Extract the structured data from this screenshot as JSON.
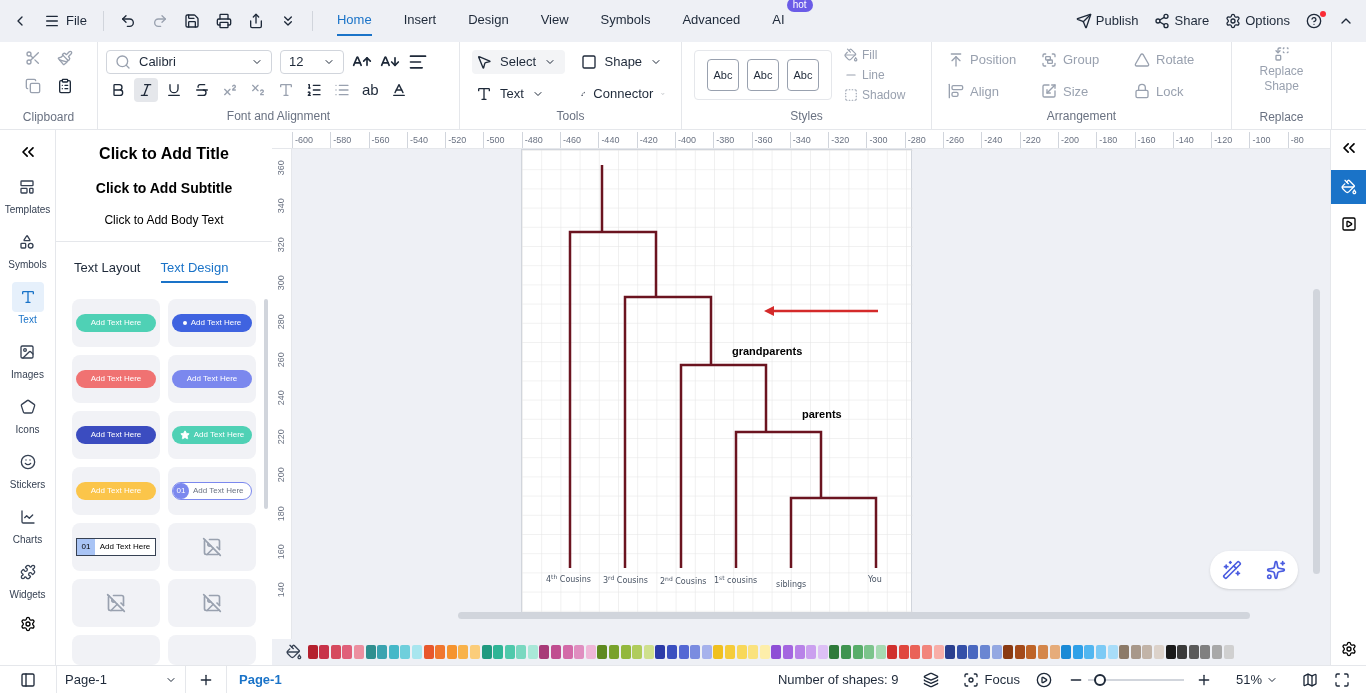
{
  "top_bar": {
    "file": "File"
  },
  "menu_tabs": [
    {
      "label": "Home",
      "selected": true
    },
    {
      "label": "Insert",
      "selected": false
    },
    {
      "label": "Design",
      "selected": false
    },
    {
      "label": "View",
      "selected": false
    },
    {
      "label": "Symbols",
      "selected": false
    },
    {
      "label": "Advanced",
      "selected": false
    },
    {
      "label": "AI",
      "selected": false,
      "badge": "hot"
    }
  ],
  "top_actions": [
    {
      "kind": "publish",
      "label": "Publish"
    },
    {
      "kind": "share",
      "label": "Share"
    },
    {
      "kind": "options",
      "label": "Options"
    }
  ],
  "help": {
    "notification": true
  },
  "ribbon": {
    "clipboard": {
      "title": "Clipboard"
    },
    "font": {
      "title": "Font and Alignment",
      "family": "Calibri",
      "size": "12",
      "formats": [
        {
          "kind": "bold",
          "selected": false,
          "disabled": false
        },
        {
          "kind": "italic",
          "selected": true,
          "disabled": false
        },
        {
          "kind": "underline",
          "selected": false,
          "disabled": false
        },
        {
          "kind": "strike",
          "selected": false,
          "disabled": false
        },
        {
          "kind": "superscript",
          "selected": false,
          "disabled": true
        },
        {
          "kind": "subscript",
          "selected": false,
          "disabled": true
        },
        {
          "kind": "effect",
          "selected": false,
          "disabled": true
        },
        {
          "kind": "spacing",
          "selected": false,
          "disabled": false
        },
        {
          "kind": "bullets",
          "selected": false,
          "disabled": true
        },
        {
          "kind": "case",
          "selected": false,
          "disabled": false,
          "label": "ab"
        },
        {
          "kind": "color",
          "selected": false,
          "disabled": false
        }
      ]
    },
    "tools": {
      "title": "Tools",
      "items": [
        {
          "kind": "select",
          "label": "Select",
          "selected": true
        },
        {
          "kind": "shape",
          "label": "Shape",
          "selected": false
        },
        {
          "kind": "text",
          "label": "Text",
          "selected": false
        },
        {
          "kind": "connector",
          "label": "Connector",
          "selected": false
        }
      ]
    },
    "styles": {
      "title": "Styles",
      "presets": [
        "Abc",
        "Abc",
        "Abc"
      ],
      "options": [
        {
          "kind": "fill",
          "label": "Fill",
          "disabled": true
        },
        {
          "kind": "line",
          "label": "Line",
          "disabled": true
        },
        {
          "kind": "shadow",
          "label": "Shadow",
          "disabled": true
        }
      ]
    },
    "arrangement": {
      "title": "Arrangement",
      "items": [
        {
          "kind": "position",
          "label": "Position",
          "disabled": true
        },
        {
          "kind": "group",
          "label": "Group",
          "disabled": true
        },
        {
          "kind": "rotate",
          "label": "Rotate",
          "disabled": true
        },
        {
          "kind": "align",
          "label": "Align",
          "disabled": true
        },
        {
          "kind": "size",
          "label": "Size",
          "disabled": true
        },
        {
          "kind": "lock",
          "label": "Lock",
          "disabled": true
        }
      ]
    },
    "replace": {
      "title": "Replace",
      "label": "Replace Shape",
      "disabled": true
    }
  },
  "sidebar": {
    "items": [
      {
        "kind": "templates",
        "label": "Templates",
        "selected": false
      },
      {
        "kind": "symbols",
        "label": "Symbols",
        "selected": false
      },
      {
        "kind": "text",
        "label": "Text",
        "selected": true
      },
      {
        "kind": "images",
        "label": "Images",
        "selected": false
      },
      {
        "kind": "icons",
        "label": "Icons",
        "selected": false
      },
      {
        "kind": "stickers",
        "label": "Stickers",
        "selected": false
      },
      {
        "kind": "charts",
        "label": "Charts",
        "selected": false
      },
      {
        "kind": "widgets",
        "label": "Widgets",
        "selected": false
      }
    ]
  },
  "panel": {
    "title": "Click to Add Title",
    "subtitle": "Click to Add Subtitle",
    "body": "Click to Add Body Text",
    "tabs": [
      {
        "label": "Text Layout",
        "selected": false
      },
      {
        "label": "Text Design",
        "selected": true
      }
    ],
    "cards": [
      {
        "kind": "pill",
        "label": "Add Text Here",
        "color": "#4fd1b5"
      },
      {
        "kind": "dot-pill",
        "label": "Add Text Here",
        "color": "#3f63e0"
      },
      {
        "kind": "pill",
        "label": "Add Text Here",
        "color": "#f07272"
      },
      {
        "kind": "pill",
        "label": "Add Text Here",
        "color": "#7b88ee"
      },
      {
        "kind": "pill",
        "label": "Add Text Here",
        "color": "#3b4cc0"
      },
      {
        "kind": "star-pill",
        "label": "Add Text Here",
        "color": "#4fd1b5"
      },
      {
        "kind": "pill",
        "label": "Add Text Here",
        "color": "#fbc54a"
      },
      {
        "kind": "outline",
        "label": "Add Text Here",
        "number": "01",
        "color": "#7b88ee"
      },
      {
        "kind": "tag",
        "label": "Add Text Here",
        "number": "01",
        "color": "#a9c4f5"
      },
      {
        "kind": "image"
      },
      {
        "kind": "image"
      },
      {
        "kind": "image"
      }
    ]
  },
  "rulers": {
    "horizontal": [
      "-600",
      "-580",
      "-560",
      "-540",
      "-520",
      "-500",
      "-480",
      "-460",
      "-440",
      "-420",
      "-400",
      "-380",
      "-360",
      "-340",
      "-320",
      "-300",
      "-280",
      "-260",
      "-240",
      "-220",
      "-200",
      "-180",
      "-160",
      "-140",
      "-120",
      "-100",
      "-80"
    ],
    "vertical": [
      "360",
      "340",
      "320",
      "300",
      "280",
      "260",
      "240",
      "220",
      "200",
      "180",
      "160",
      "140"
    ]
  },
  "diagram": {
    "leaves": [
      "4$^{th}$ Cousins",
      "3$^{rd}$ Cousins",
      "2$^{nd}$ Cousins",
      "1$^{st}$ cousins",
      "siblings",
      "You"
    ],
    "annotations": [
      "grandparents",
      "parents"
    ]
  },
  "palette": [
    {
      "color": "#b5202e"
    },
    {
      "color": "#c8334a"
    },
    {
      "color": "#d64a5e"
    },
    {
      "color": "#e0607a"
    },
    {
      "color": "#ec8fa0"
    },
    {
      "color": "#2f8f8f"
    },
    {
      "color": "#3aa3b0"
    },
    {
      "color": "#45b8c8"
    },
    {
      "color": "#6fcfdc"
    },
    {
      "color": "#a8e6ef"
    },
    {
      "color": "#e8582c"
    },
    {
      "color": "#f0772f"
    },
    {
      "color": "#f5942f"
    },
    {
      "color": "#f8b24a"
    },
    {
      "color": "#fbcd7a"
    },
    {
      "color": "#1f9a80"
    },
    {
      "color": "#2fb596"
    },
    {
      "color": "#4fc9ab"
    },
    {
      "color": "#7ad8c0"
    },
    {
      "color": "#a9e8d8"
    },
    {
      "color": "#a83a78"
    },
    {
      "color": "#c04e90"
    },
    {
      "color": "#d36aa8"
    },
    {
      "color": "#e08ec0"
    },
    {
      "color": "#efb7d8"
    },
    {
      "color": "#5e8a1f"
    },
    {
      "color": "#78a22b"
    },
    {
      "color": "#93b83d"
    },
    {
      "color": "#b0cc5c"
    },
    {
      "color": "#cfe08e"
    },
    {
      "color": "#2b3aa8"
    },
    {
      "color": "#3a4fc0"
    },
    {
      "color": "#5468d4"
    },
    {
      "color": "#7a8ce0"
    },
    {
      "color": "#a6b2ec"
    },
    {
      "color": "#f0c020"
    },
    {
      "color": "#f5cc3a"
    },
    {
      "color": "#f8d85a"
    },
    {
      "color": "#fae27e"
    },
    {
      "color": "#fdeeaa"
    },
    {
      "color": "#8e4fd6"
    },
    {
      "color": "#a466e0"
    },
    {
      "color": "#b882e8"
    },
    {
      "color": "#cba0ef"
    },
    {
      "color": "#ddc0f5"
    },
    {
      "color": "#2e7a3a"
    },
    {
      "color": "#3f9450"
    },
    {
      "color": "#58ad6a"
    },
    {
      "color": "#7cc48c"
    },
    {
      "color": "#a6dab2"
    },
    {
      "color": "#d0302e"
    },
    {
      "color": "#e0463e"
    },
    {
      "color": "#ea6258"
    },
    {
      "color": "#f2857c"
    },
    {
      "color": "#f8aea8"
    },
    {
      "color": "#2a3f8f"
    },
    {
      "color": "#3450a8"
    },
    {
      "color": "#4a68c0"
    },
    {
      "color": "#6a86d2"
    },
    {
      "color": "#94a8e2"
    },
    {
      "color": "#8a3a12"
    },
    {
      "color": "#a44a1a"
    },
    {
      "color": "#be6428"
    },
    {
      "color": "#d4864a"
    },
    {
      "color": "#e6ac7a"
    },
    {
      "color": "#1a8ad6"
    },
    {
      "color": "#2fa0e8"
    },
    {
      "color": "#52b6f0"
    },
    {
      "color": "#7ccaf5"
    },
    {
      "color": "#a8ddf9"
    },
    {
      "color": "#8c7a68"
    },
    {
      "color": "#a8988a"
    },
    {
      "color": "#c2b4a8"
    },
    {
      "color": "#dcd2ca"
    },
    {
      "color": "#1a1a1a"
    },
    {
      "color": "#3a3a3a"
    },
    {
      "color": "#5a5a5a"
    },
    {
      "color": "#808080"
    },
    {
      "color": "#a8a8a8"
    },
    {
      "color": "#d0d0d0"
    }
  ],
  "status": {
    "page_selector": "Page-1",
    "page_tabs": [
      {
        "label": "Page-1",
        "selected": true
      }
    ],
    "shapes": "Number of shapes: 9",
    "focus": "Focus",
    "zoom": {
      "level": 0.13,
      "reading": "51%"
    }
  }
}
